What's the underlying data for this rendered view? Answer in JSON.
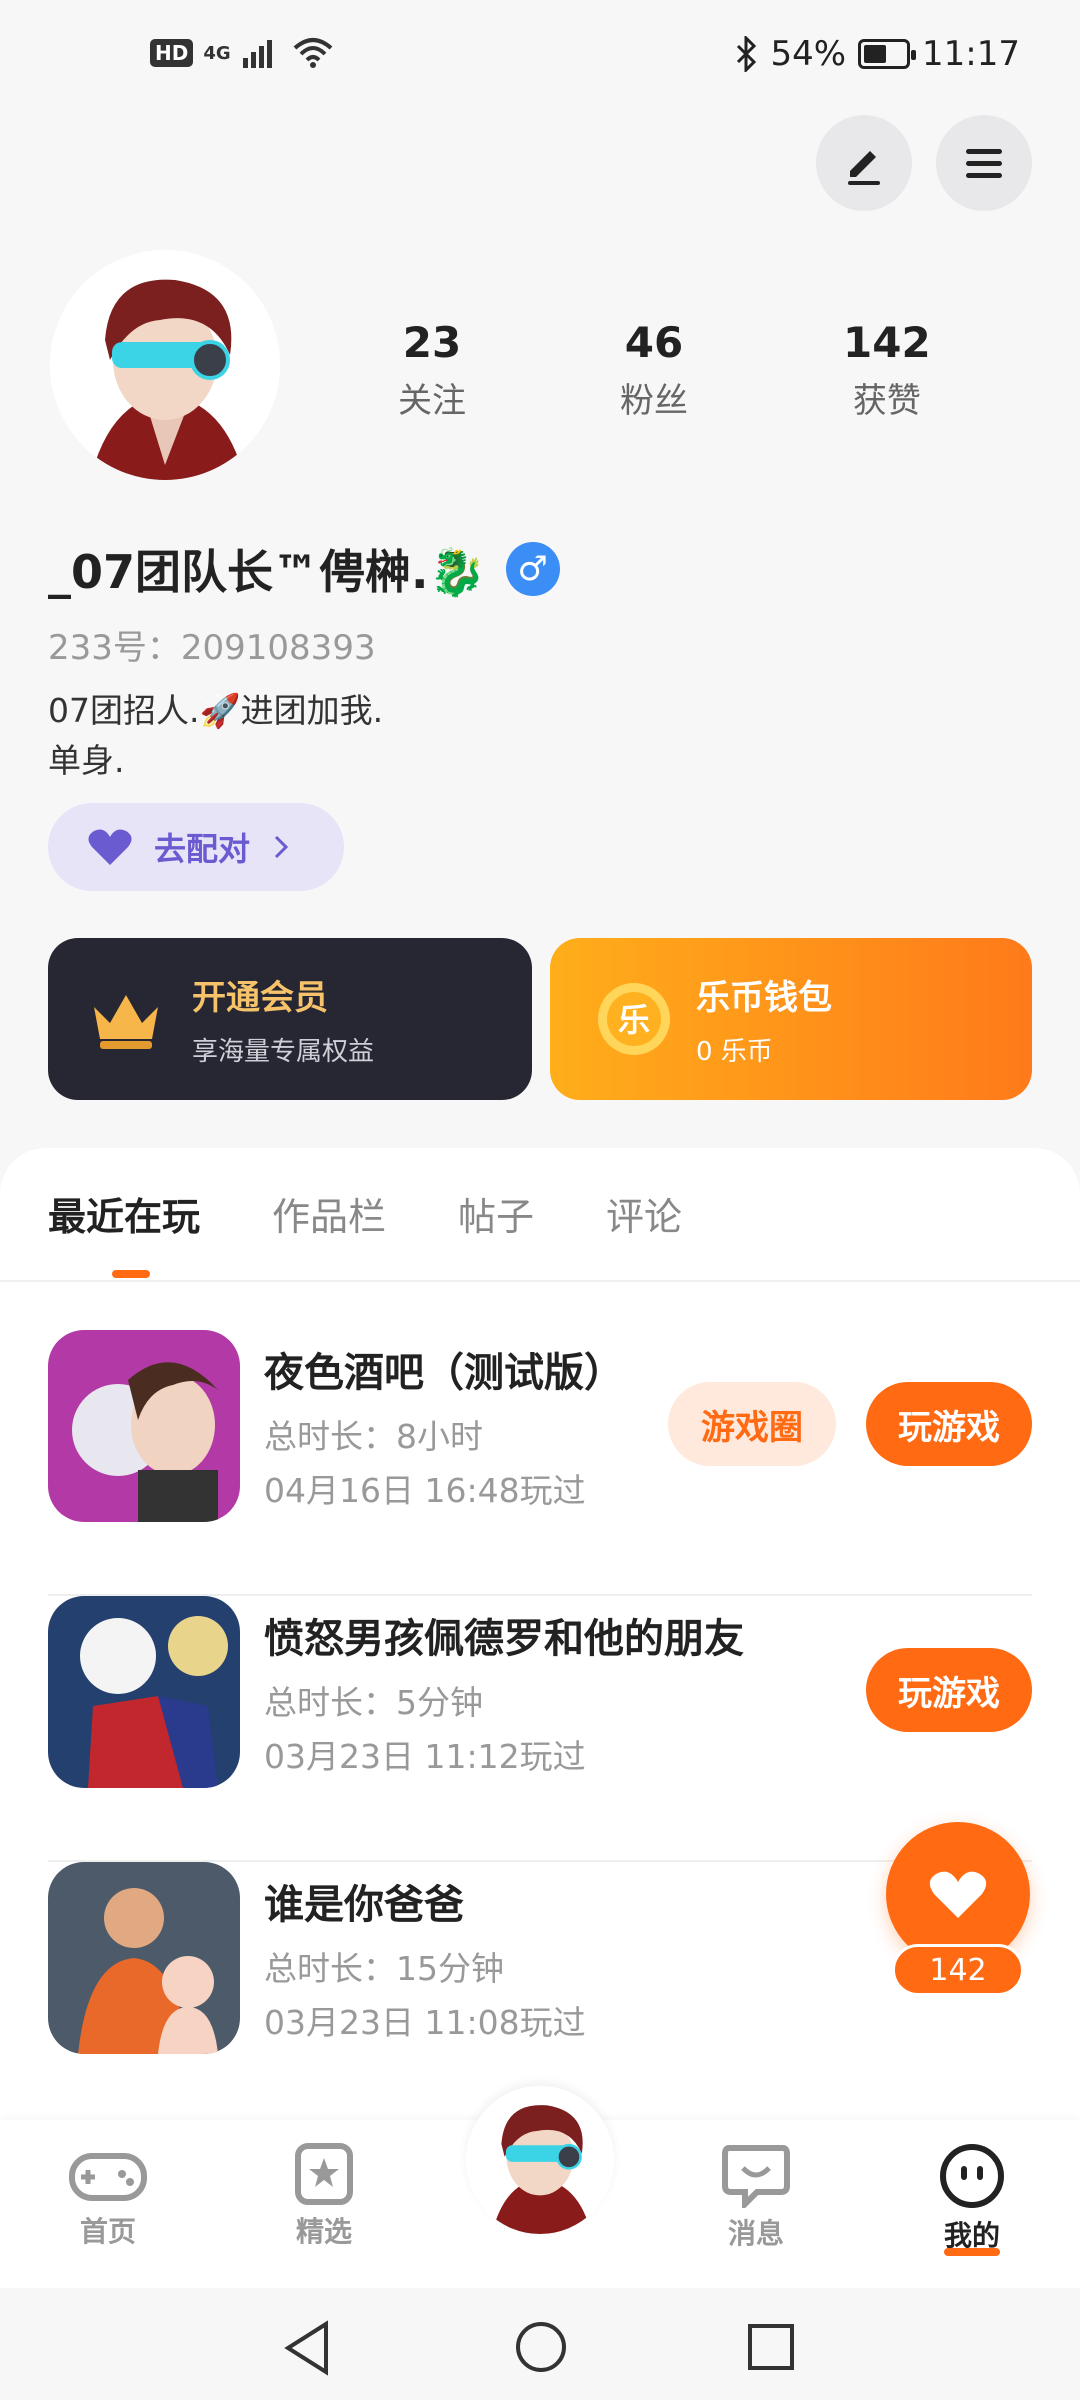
{
  "status_bar": {
    "hd": "HD",
    "network": "4G",
    "battery_percent": "54%",
    "battery_level": 0.54,
    "time": "11:17"
  },
  "header": {
    "edit_icon": "edit-icon",
    "menu_icon": "menu-icon"
  },
  "profile": {
    "avatar": "avatar",
    "stats": [
      {
        "value": "23",
        "label": "关注"
      },
      {
        "value": "46",
        "label": "粉丝"
      },
      {
        "value": "142",
        "label": "获赞"
      }
    ],
    "username": "_07团队长™俜榊.🐉",
    "gender_symbol": "♂",
    "uid": "233号：209108393",
    "bio_line1": "07团招人.🚀进团加我.",
    "bio_line2": "单身.",
    "match_label": "去配对"
  },
  "cards": {
    "vip_title": "开通会员",
    "vip_sub": "享海量专属权益",
    "wallet_title": "乐币钱包",
    "wallet_sub": "0 乐币",
    "wallet_coin": "乐"
  },
  "tabs": [
    "最近在玩",
    "作品栏",
    "帖子",
    "评论"
  ],
  "games": [
    {
      "title": "夜色酒吧（测试版）",
      "duration": "总时长：8小时",
      "played": "04月16日 16:48玩过",
      "circle": "游戏圈",
      "play": "玩游戏"
    },
    {
      "title": "愤怒男孩佩德罗和他的朋友",
      "duration": "总时长：5分钟",
      "played": "03月23日 11:12玩过",
      "play": "玩游戏"
    },
    {
      "title": "谁是你爸爸",
      "duration": "总时长：15分钟",
      "played": "03月23日 11:08玩过"
    }
  ],
  "like_fab": {
    "count": "142"
  },
  "bottom_nav": {
    "home": "首页",
    "featured": "精选",
    "messages": "消息",
    "mine": "我的"
  },
  "colors": {
    "accent": "#ff6a13",
    "match": "#6a5bd1",
    "vip_bg": "#272633",
    "gender": "#3a8ef5"
  }
}
